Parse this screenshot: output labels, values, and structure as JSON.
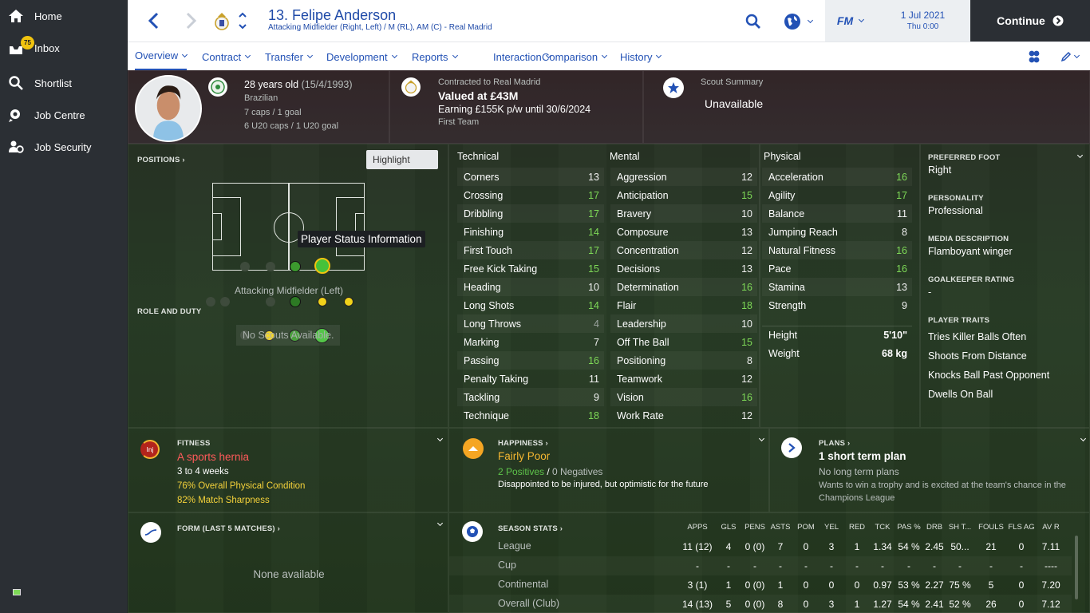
{
  "sidebar": {
    "items": [
      {
        "label": "Home",
        "icon": "home-icon"
      },
      {
        "label": "Inbox",
        "icon": "inbox-icon",
        "badge": "75"
      },
      {
        "label": "Shortlist",
        "icon": "search-icon"
      },
      {
        "label": "Job Centre",
        "icon": "job-centre-icon"
      },
      {
        "label": "Job Security",
        "icon": "job-security-icon"
      }
    ]
  },
  "header": {
    "title": "13. Felipe Anderson",
    "subtitle": "Attacking Midfielder (Right, Left) / M (RL), AM (C) - Real Madrid",
    "game_logo": "FM",
    "date": "1 Jul 2021",
    "time": "Thu 0:00",
    "continue_label": "Continue"
  },
  "tabs": [
    {
      "label": "Overview"
    },
    {
      "label": "Contract"
    },
    {
      "label": "Transfer"
    },
    {
      "label": "Development"
    },
    {
      "label": "Reports"
    },
    {
      "label": "Interaction"
    },
    {
      "label": "Comparison"
    },
    {
      "label": "History"
    }
  ],
  "profile": {
    "age": "28 years old",
    "dob": "(15/4/1993)",
    "nationality": "Brazilian",
    "caps": "7 caps / 1 goal",
    "u20_caps": "6 U20 caps / 1 U20 goal",
    "contract_label": "Contracted to Real Madrid",
    "value": "Valued at £43M",
    "earning": "Earning £155K p/w until 30/6/2024",
    "squad": "First Team",
    "scout_label": "Scout Summary",
    "scout_value": "Unavailable"
  },
  "positions": {
    "label": "POSITIONS",
    "highlight": "Highlight",
    "tooltip": "Player Status Information",
    "caption": "Attacking Midfielder (Left)",
    "role_label": "ROLE AND DUTY",
    "no_scouts": "No Scouts Available."
  },
  "attributes": {
    "technical_title": "Technical",
    "mental_title": "Mental",
    "physical_title": "Physical",
    "technical": [
      [
        "Corners",
        "13"
      ],
      [
        "Crossing",
        "17"
      ],
      [
        "Dribbling",
        "17"
      ],
      [
        "Finishing",
        "14"
      ],
      [
        "First Touch",
        "17"
      ],
      [
        "Free Kick Taking",
        "15"
      ],
      [
        "Heading",
        "10"
      ],
      [
        "Long Shots",
        "14"
      ],
      [
        "Long Throws",
        "4"
      ],
      [
        "Marking",
        "7"
      ],
      [
        "Passing",
        "16"
      ],
      [
        "Penalty Taking",
        "11"
      ],
      [
        "Tackling",
        "9"
      ],
      [
        "Technique",
        "18"
      ]
    ],
    "mental": [
      [
        "Aggression",
        "12"
      ],
      [
        "Anticipation",
        "15"
      ],
      [
        "Bravery",
        "10"
      ],
      [
        "Composure",
        "13"
      ],
      [
        "Concentration",
        "12"
      ],
      [
        "Decisions",
        "13"
      ],
      [
        "Determination",
        "16"
      ],
      [
        "Flair",
        "18"
      ],
      [
        "Leadership",
        "10"
      ],
      [
        "Off The Ball",
        "15"
      ],
      [
        "Positioning",
        "8"
      ],
      [
        "Teamwork",
        "12"
      ],
      [
        "Vision",
        "16"
      ],
      [
        "Work Rate",
        "12"
      ]
    ],
    "physical": [
      [
        "Acceleration",
        "16"
      ],
      [
        "Agility",
        "17"
      ],
      [
        "Balance",
        "11"
      ],
      [
        "Jumping Reach",
        "8"
      ],
      [
        "Natural Fitness",
        "16"
      ],
      [
        "Pace",
        "16"
      ],
      [
        "Stamina",
        "13"
      ],
      [
        "Strength",
        "9"
      ]
    ],
    "height_label": "Height",
    "height": "5'10\"",
    "weight_label": "Weight",
    "weight": "68 kg"
  },
  "info": {
    "foot_label": "PREFERRED FOOT",
    "foot": "Right",
    "personality_label": "PERSONALITY",
    "personality": "Professional",
    "media_label": "MEDIA DESCRIPTION",
    "media": "Flamboyant winger",
    "gk_label": "GOALKEEPER RATING",
    "gk": "-",
    "traits_label": "PLAYER TRAITS",
    "traits": [
      "Tries Killer Balls Often",
      "Shoots From Distance",
      "Knocks Ball Past Opponent",
      "Dwells On Ball"
    ]
  },
  "fitness": {
    "label": "FITNESS",
    "icon_text": "Inj",
    "injury": "A sports hernia",
    "duration": "3 to 4 weeks",
    "condition": "76% Overall Physical Condition",
    "sharpness": "82% Match Sharpness"
  },
  "happiness": {
    "label": "HAPPINESS",
    "status": "Fairly Poor",
    "positives": "2 Positives",
    "negatives": "0 Negatives",
    "text": "Disappointed to be injured, but optimistic for the future"
  },
  "plans": {
    "label": "PLANS",
    "title": "1 short term plan",
    "subtitle": "No long term plans",
    "text": "Wants to win a trophy and is excited at the team's chance in the Champions League"
  },
  "form": {
    "label": "FORM (LAST 5 MATCHES)",
    "empty": "None available"
  },
  "season": {
    "label": "SEASON STATS",
    "headers": [
      "APPS",
      "GLS",
      "PENS",
      "ASTS",
      "POM",
      "YEL",
      "RED",
      "TCK",
      "PAS %",
      "DRB",
      "SH T...",
      "FOULS",
      "FLS AG",
      "AV R"
    ],
    "rows": [
      {
        "name": "League",
        "vals": [
          "11 (12)",
          "4",
          "0 (0)",
          "7",
          "0",
          "3",
          "1",
          "1.34",
          "54 %",
          "2.45",
          "50...",
          "21",
          "0",
          "7.11"
        ]
      },
      {
        "name": "Cup",
        "vals": [
          "-",
          "-",
          "-",
          "-",
          "-",
          "-",
          "-",
          "-",
          "-",
          "-",
          "-",
          "-",
          "-",
          "----"
        ]
      },
      {
        "name": "Continental",
        "vals": [
          "3 (1)",
          "1",
          "0 (0)",
          "1",
          "0",
          "0",
          "0",
          "0.97",
          "53 %",
          "2.27",
          "75 %",
          "5",
          "0",
          "7.20"
        ]
      },
      {
        "name": "Overall (Club)",
        "vals": [
          "14 (13)",
          "5",
          "0 (0)",
          "8",
          "0",
          "3",
          "1",
          "1.27",
          "54 %",
          "2.41",
          "52 %",
          "26",
          "0",
          "7.12"
        ]
      }
    ]
  },
  "colors": {
    "accent": "#2251b5",
    "good": "#7ed957",
    "injury": "#ff5a5a",
    "warning": "#f5b731",
    "dark": "#2b2f34"
  }
}
